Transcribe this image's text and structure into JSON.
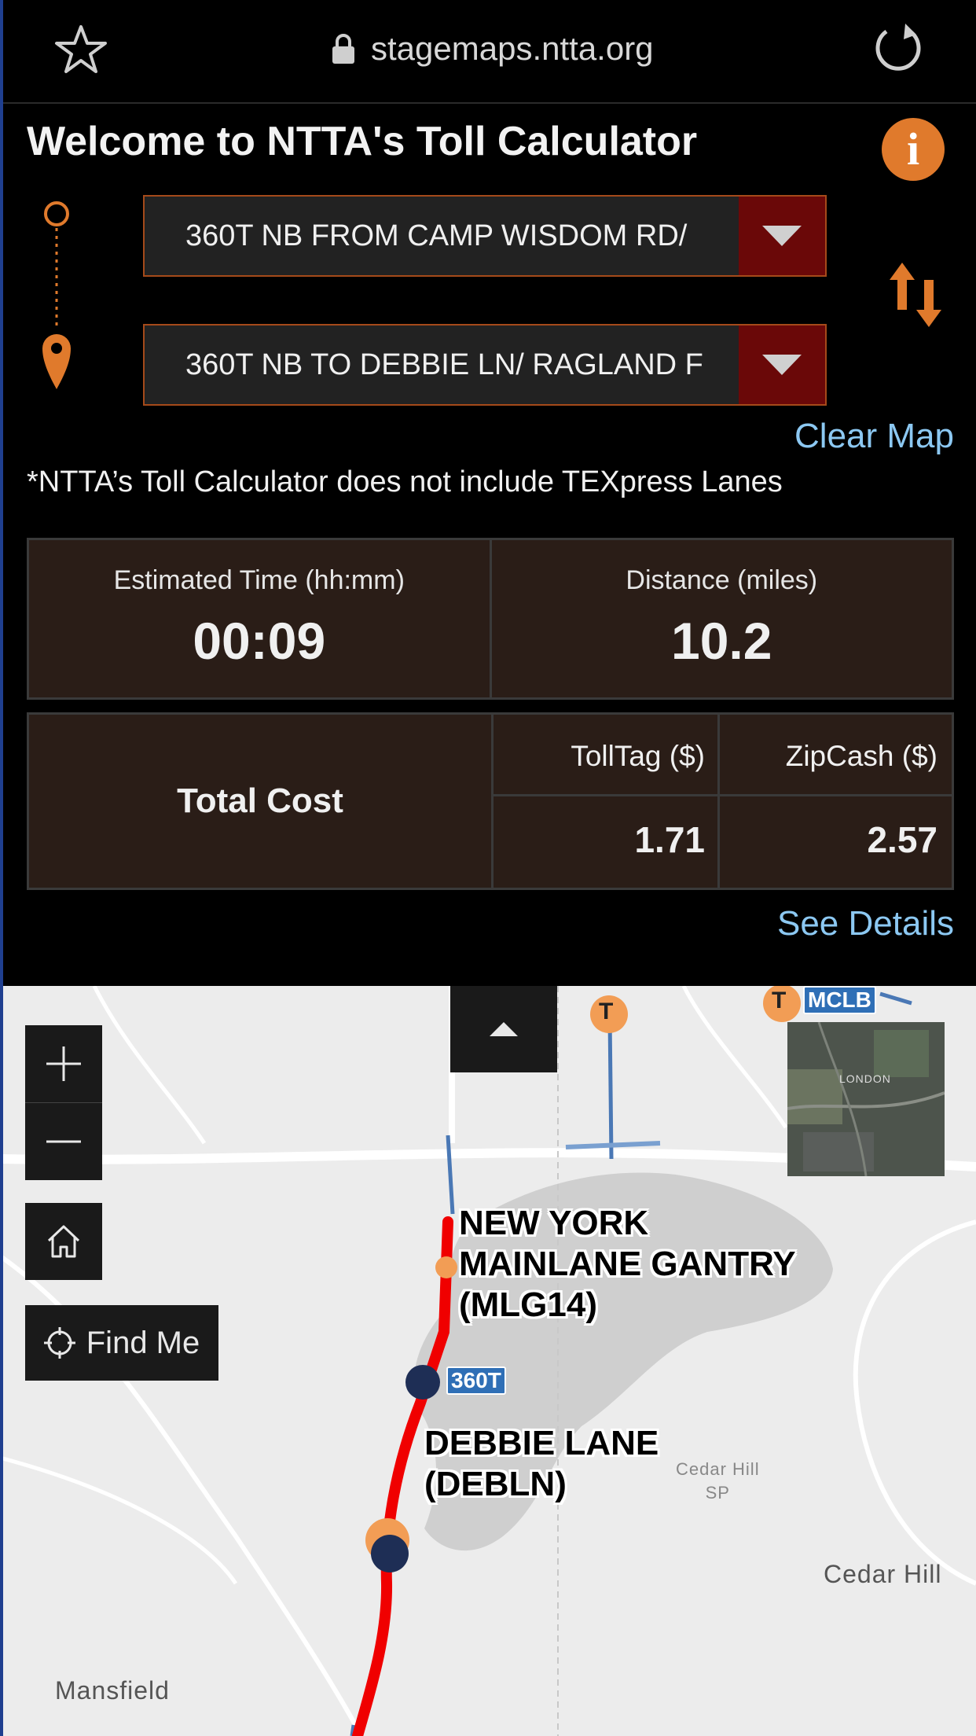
{
  "browser": {
    "url": "stagemaps.ntta.org"
  },
  "calculator": {
    "title": "Welcome to NTTA's Toll Calculator",
    "from_value": "360T NB FROM CAMP WISDOM RD/",
    "to_value": "360T NB TO DEBBIE LN/ RAGLAND F",
    "clear_map": "Clear Map",
    "disclaimer": "*NTTA’s Toll Calculator does not include TEXpress Lanes",
    "estimated_time_label": "Estimated Time (hh:mm)",
    "estimated_time_value": "00:09",
    "distance_label": "Distance (miles)",
    "distance_value": "10.2",
    "total_cost_label": "Total Cost",
    "tolltag_label": "TollTag ($)",
    "zipcash_label": "ZipCash ($)",
    "tolltag_value": "1.71",
    "zipcash_value": "2.57",
    "see_details": "See Details"
  },
  "map": {
    "find_me": "Find Me",
    "gantry_1": [
      "NEW YORK",
      "MAINLANE GANTRY",
      "(MLG14)"
    ],
    "gantry_2": [
      "DEBBIE LANE",
      "(DEBLN)"
    ],
    "shield_360t": "360T",
    "shield_mclb": "MCLB",
    "toll_marker": "T",
    "places": {
      "cedar_hill": "Cedar Hill",
      "cedar_hill_sp_1": "Cedar Hill",
      "cedar_hill_sp_2": "SP",
      "mansfield": "Mansfield",
      "london": "LONDON"
    }
  },
  "colors": {
    "accent_orange": "#e07a2c",
    "link_blue": "#8cc8f2",
    "caret_red": "#6a0808",
    "route_red": "#f00000",
    "panel_brown": "#2a1d17"
  }
}
